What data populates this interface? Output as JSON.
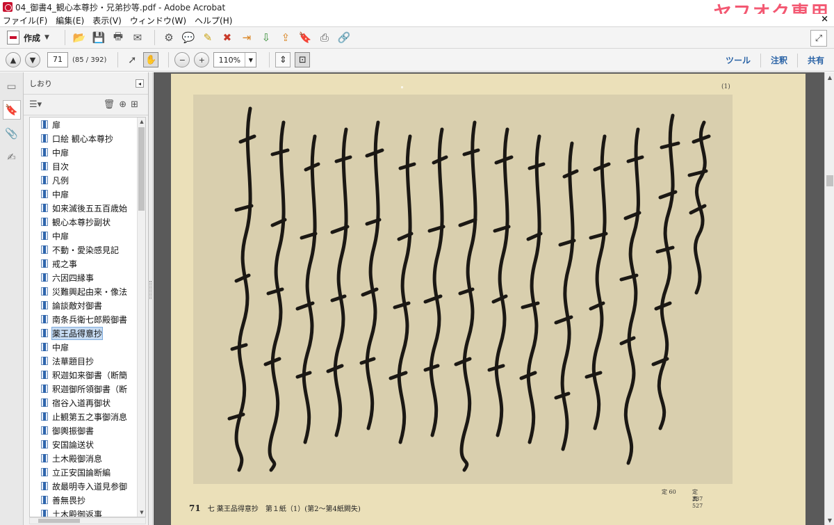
{
  "window": {
    "title": "04_御書4_観心本尊抄・兄弟抄等.pdf - Adobe Acrobat",
    "watermark": "ヤフオク専用"
  },
  "menubar": {
    "items": [
      "ファイル(F)",
      "編集(E)",
      "表示(V)",
      "ウィンドウ(W)",
      "ヘルプ(H)"
    ],
    "close": "×"
  },
  "toolbar": {
    "create_label": "作成"
  },
  "nav": {
    "current_page": "71",
    "page_count": "(85 / 392)",
    "zoom": "110%",
    "links": [
      "ツール",
      "注釈",
      "共有"
    ]
  },
  "bookmarks": {
    "panel_title": "しおり",
    "items": [
      "扉",
      "口絵 観心本尊抄",
      "中扉",
      "目次",
      "凡例",
      "中扉",
      "如来滅後五五百歳始",
      "観心本尊抄副状",
      "中扉",
      "不動・愛染感見記",
      "戒之事",
      "六因四縁事",
      "災難興起由来・像法",
      "論談敵対御書",
      "南条兵衛七郎殿御書",
      "薬王品得意抄",
      "中扉",
      "法華題目抄",
      "釈迦如来御書（断簡",
      "釈迦御所領御書（断",
      "宿谷入道再御状",
      "止観第五之事御消息",
      "御輿振御書",
      "安国論送状",
      "土木殿御消息",
      "立正安国論断編",
      "故最明寺入道見参御",
      "善無畏抄",
      "土木殿御返事"
    ],
    "selected_index": 15
  },
  "document": {
    "page_marker": "(1)",
    "footer_page": "71",
    "footer_title": "七 薬王品得意抄",
    "footer_detail": "第１紙（1）(第2〜第4紙闕失)",
    "footer_right_1": "定 60",
    "footer_right_2": "定 337",
    "footer_right_3": "真 527"
  },
  "colors": {
    "accent_blue": "#2a63a6",
    "watermark_pink": "#f23b5a",
    "page_paper": "#ebe0b9",
    "background": "#5a5a5a"
  }
}
